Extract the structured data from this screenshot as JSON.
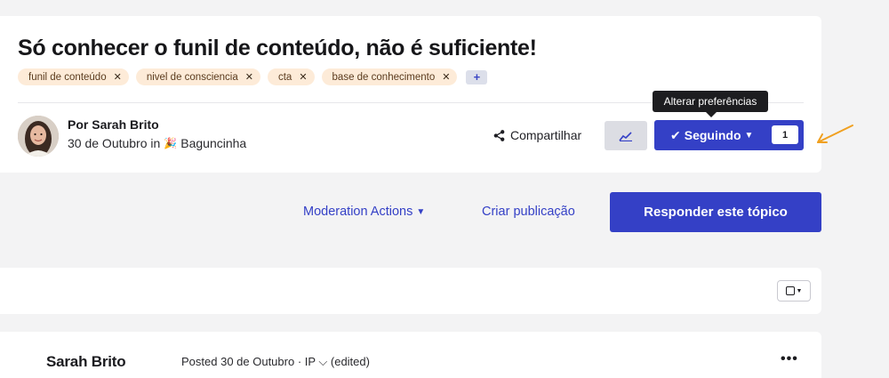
{
  "topic": {
    "title": "Só conhecer o funil de conteúdo, não é suficiente!",
    "tags": [
      {
        "label": "funil de conteúdo",
        "remove": "✕"
      },
      {
        "label": "nivel de consciencia",
        "remove": "✕"
      },
      {
        "label": "cta",
        "remove": "✕"
      },
      {
        "label": "base de conhecimento",
        "remove": "✕"
      }
    ],
    "add_tag": "+"
  },
  "author": {
    "name": "Por Sarah Brito",
    "date": "30 de Outubro in",
    "category": "Baguncinha"
  },
  "actions": {
    "share": "Compartilhar",
    "follow": "Seguindo",
    "follow_count": "1",
    "tooltip": "Alterar preferências"
  },
  "toolbar": {
    "moderation": "Moderation Actions",
    "create_post": "Criar publicação",
    "reply": "Responder este tópico"
  },
  "post": {
    "author": "Sarah Brito",
    "meta": "Posted 30 de Outubro · IP ⌵ (edited)",
    "more": "•••"
  },
  "colors": {
    "accent": "#3440c6",
    "tag_bg": "#fdebd8",
    "annotation_arrow": "#f0a020"
  }
}
